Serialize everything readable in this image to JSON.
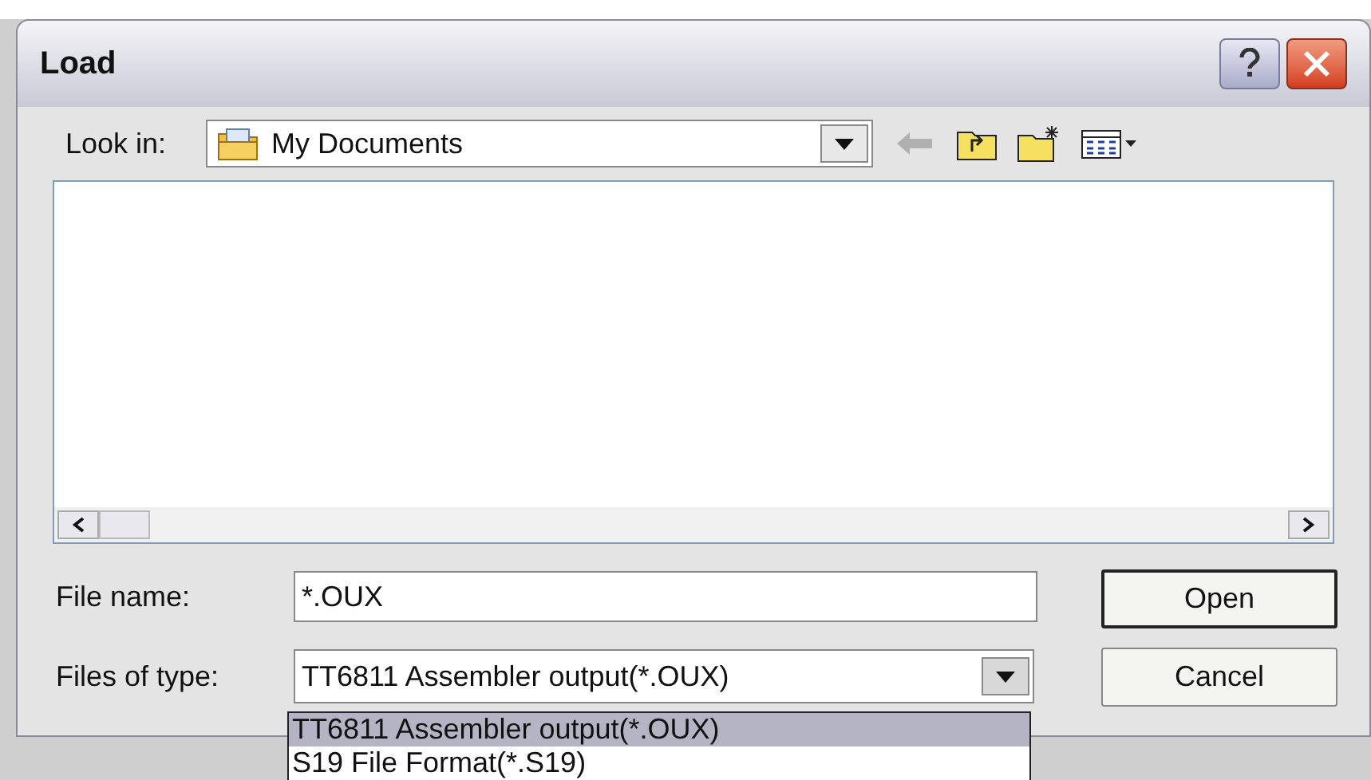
{
  "window": {
    "title": "Load"
  },
  "look_in": {
    "label": "Look in:",
    "value": "My Documents"
  },
  "file_name": {
    "label": "File name:",
    "value": "*.OUX"
  },
  "files_of_type": {
    "label": "Files of type:",
    "value": "TT6811 Assembler output(*.OUX)",
    "expanded": true,
    "options": [
      {
        "label": "TT6811 Assembler output(*.OUX)",
        "selected": true
      },
      {
        "label": "S19 File Format(*.S19)",
        "selected": false
      }
    ]
  },
  "buttons": [
    {
      "label": "Open",
      "default": true
    },
    {
      "label": "Cancel",
      "default": false
    }
  ]
}
